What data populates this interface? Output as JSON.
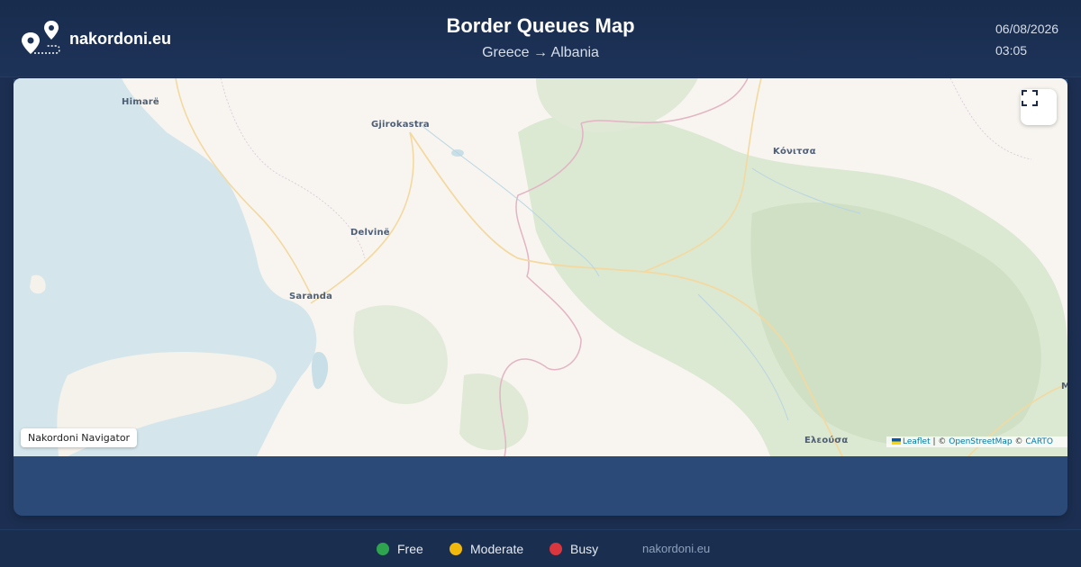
{
  "header": {
    "brand": "nakordoni.eu",
    "title": "Border Queues Map",
    "subtitle": "Greece → Albania",
    "date": "06/08/2026",
    "time": "03:05"
  },
  "map": {
    "places": {
      "himare": "Himarë",
      "gjirokastra": "Gjirokastra",
      "konitsa": "Κόνιτσα",
      "delvine": "Delvinë",
      "saranda": "Saranda",
      "eleousa": "Ελεούσα",
      "m_edge": "M"
    },
    "navigator_label": "Nakordoni Navigator",
    "fullscreen_icon": "fullscreen-icon",
    "attribution": {
      "leaflet": "Leaflet",
      "separator": " | © ",
      "osm": "OpenStreetMap",
      "copy": " © ",
      "carto": "CARTO"
    }
  },
  "legend": [
    {
      "label": "Free",
      "color": "#2ea44f"
    },
    {
      "label": "Moderate",
      "color": "#f0b90b"
    },
    {
      "label": "Busy",
      "color": "#d9363e"
    }
  ],
  "footer": {
    "site": "nakordoni.eu"
  },
  "colors": {
    "header_bg": "#182c4d",
    "panel_bg": "#2b4a78",
    "sea": "#d4e6ec",
    "land": "#f8f5f0",
    "forest": "#dbe8d2"
  }
}
